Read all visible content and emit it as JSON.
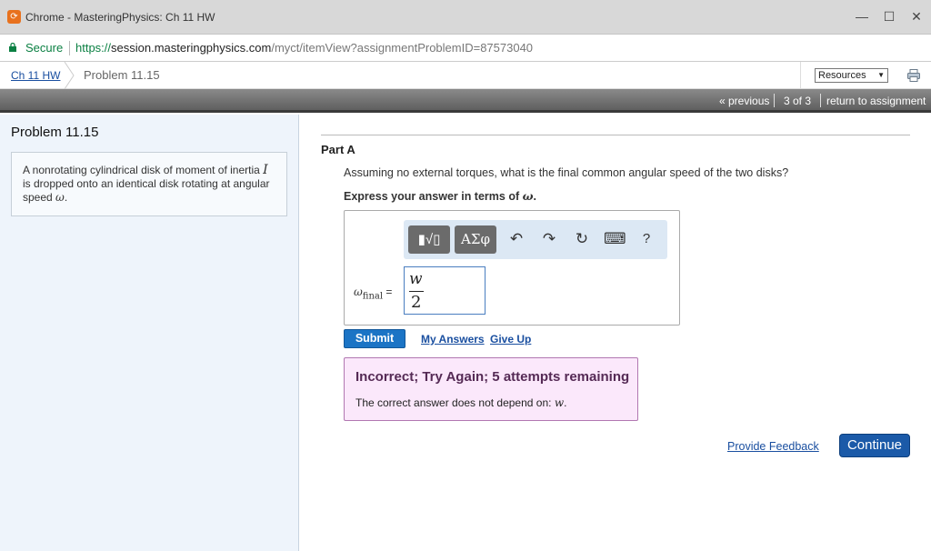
{
  "window": {
    "title": "Chrome - MasteringPhysics: Ch 11 HW",
    "minimize": "—",
    "maximize": "☐",
    "close": "✕"
  },
  "address": {
    "secure_label": "Secure",
    "url_scheme": "https://",
    "url_host": "session.masteringphysics.com",
    "url_path": "/myct/itemView?assignmentProblemID=87573040"
  },
  "breadcrumb": {
    "parent": "Ch 11 HW",
    "current": "Problem 11.15",
    "resources_label": "Resources"
  },
  "nav": {
    "previous": "« previous",
    "position": "3 of 3",
    "return": "return to assignment"
  },
  "problem": {
    "title": "Problem 11.15",
    "text_before": "A nonrotating cylindrical disk of moment of inertia ",
    "symbol_inertia": "I",
    "text_middle": " is dropped onto an identical disk rotating at angular speed ",
    "symbol_omega": "ω",
    "text_end": "."
  },
  "part": {
    "label": "Part A",
    "question": "Assuming no external torques, what is the final common angular speed of the two disks?",
    "express_prefix": "Express your answer in terms of ",
    "express_symbol": "ω",
    "express_suffix": ".",
    "answer_var": "ω",
    "answer_sub": "final",
    "equals": "=",
    "answer_numerator": "w",
    "answer_denominator": "2",
    "toolbar": {
      "templates_label": "▮√▯",
      "greek_label": "ΑΣφ",
      "undo": "↶",
      "redo": "↷",
      "reset": "↻",
      "keyboard": "⌨",
      "help": "?"
    },
    "submit_label": "Submit",
    "my_answers_label": "My Answers",
    "give_up_label": "Give Up",
    "feedback": {
      "title": "Incorrect; Try Again; 5 attempts remaining",
      "text_prefix": "The correct answer does not depend on: ",
      "text_symbol": "w",
      "text_suffix": "."
    }
  },
  "footer": {
    "provide_feedback": "Provide Feedback",
    "continue": "Continue"
  },
  "colors": {
    "submit": "#1b74c5",
    "continue": "#1b5aa8",
    "feedback_bg": "#fbe8fb",
    "left_panel_bg": "#eef4fb"
  }
}
